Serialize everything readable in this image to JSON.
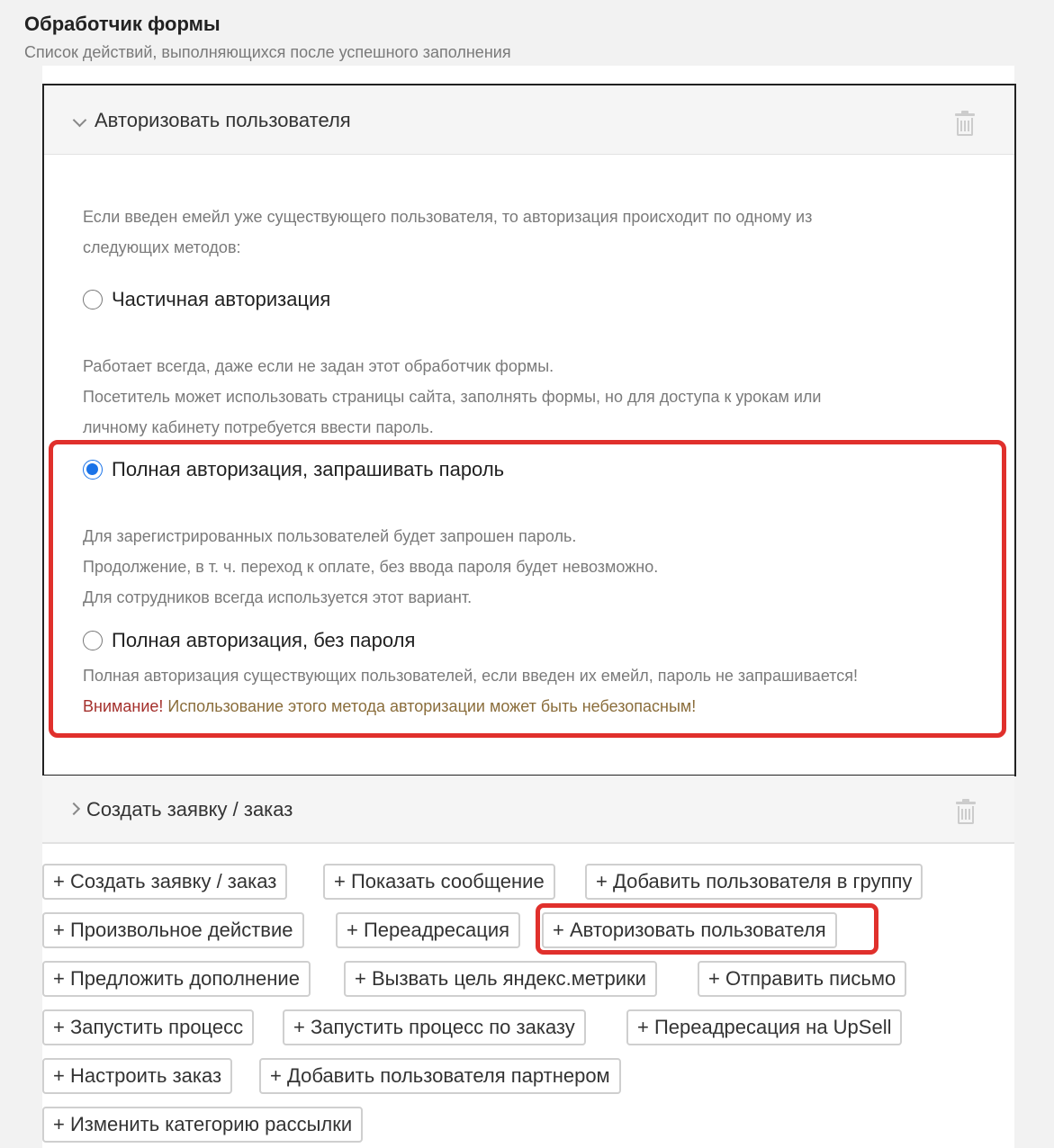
{
  "header": {
    "title": "Обработчик формы",
    "subtitle": "Список действий, выполняющихся после успешного заполнения"
  },
  "handlers": [
    {
      "title": "Авторизовать пользователя",
      "expanded": true,
      "intro_line1": "Если введен емейл уже существующего пользователя, то авторизация происходит по одному из",
      "intro_line2": "следующих методов:",
      "options": [
        {
          "label": "Частичная авторизация",
          "selected": false,
          "desc": [
            "Работает всегда, даже если не задан этот обработчик формы.",
            "Посетитель может использовать страницы сайта, заполнять формы, но для доступа к урокам или",
            "личному кабинету потребуется ввести пароль."
          ]
        },
        {
          "label": "Полная авторизация, запрашивать пароль",
          "selected": true,
          "desc": [
            "Для зарегистрированных пользователей будет запрошен пароль.",
            "Продолжение, в т. ч. переход к оплате, без ввода пароля будет невозможно.",
            "Для сотрудников всегда используется этот вариант."
          ]
        },
        {
          "label": "Полная авторизация, без пароля",
          "selected": false,
          "desc": [
            "Полная авторизация существующих пользователей, если введен их емейл, пароль не запрашивается!"
          ],
          "warning_prefix": "Внимание!",
          "warning_text": " Использование этого метода авторизации может быть небезопасным!"
        }
      ]
    },
    {
      "title": "Создать заявку / заказ",
      "expanded": false
    }
  ],
  "add_buttons": [
    "+ Создать заявку / заказ",
    "+ Показать сообщение",
    "+ Добавить пользователя в группу",
    "+ Произвольное действие",
    "+ Переадресация",
    "+ Авторизовать пользователя",
    "+ Предложить дополнение",
    "+ Вызвать цель яндекс.метрики",
    "+ Отправить письмо",
    "+ Запустить процесс",
    "+ Запустить процесс по заказу",
    "+ Переадресация на UpSell",
    "+ Настроить заказ",
    "+ Добавить пользователя партнером",
    "+ Изменить категорию рассылки"
  ],
  "colors": {
    "accent": "#1a73e8",
    "highlight": "#e0302c",
    "warning_red": "#a4302c",
    "warning_olive": "#8a6d3b"
  },
  "icons": {
    "collapse": "chevron-down-icon",
    "expand": "chevron-right-icon",
    "delete": "trash-icon"
  }
}
